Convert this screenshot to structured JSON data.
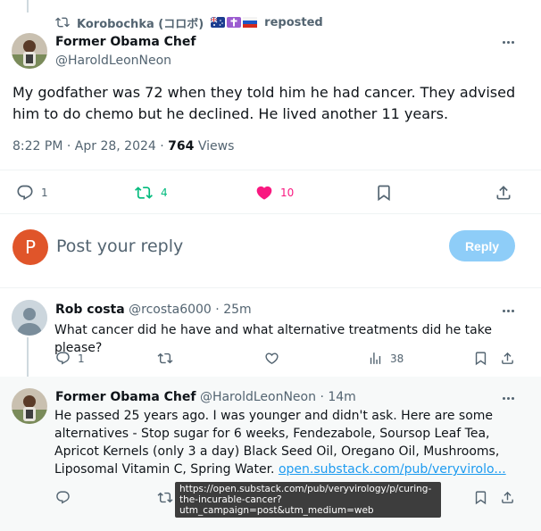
{
  "repost": {
    "label": "Korobochka (コロボ)",
    "suffix": "reposted"
  },
  "main_post": {
    "author_name": "Former Obama Chef",
    "author_handle": "@HaroldLeonNeon",
    "text": "My godfather was 72 when they told him he had cancer. They advised him to do chemo but he declined. He lived another 11 years.",
    "time": "8:22 PM",
    "date": "Apr 28, 2024",
    "views_count": "764",
    "views_label": "Views",
    "replies": "1",
    "reposts": "4",
    "likes": "10",
    "colors": {
      "repost": "#00ba7c",
      "like": "#f91880"
    }
  },
  "composer": {
    "avatar_letter": "P",
    "placeholder": "Post your reply",
    "reply_button": "Reply"
  },
  "reply1": {
    "author_name": "Rob costa",
    "author_handle": "@rcosta6000",
    "time": "25m",
    "text": "What cancer did he have and what alternative treatments did he take please?",
    "replies": "1",
    "views": "38"
  },
  "reply2": {
    "author_name": "Former Obama Chef",
    "author_handle": "@HaroldLeonNeon",
    "time": "14m",
    "text": "He passed 25 years ago. I was younger and didn't ask. Here are some alternatives - Stop sugar for 6 weeks, Fendezabole, Soursop Leaf Tea, Apricot Kernels (only 3 a day) Black Seed Oil, Oregano Oil, Mushrooms, Liposomal Vitamin C, Spring Water.",
    "link_text": "open.substack.com/pub/veryvirolo...",
    "tooltip": "https://open.substack.com/pub/veryvirology/p/curing-the-incurable-cancer?utm_campaign=post&utm_medium=web"
  }
}
